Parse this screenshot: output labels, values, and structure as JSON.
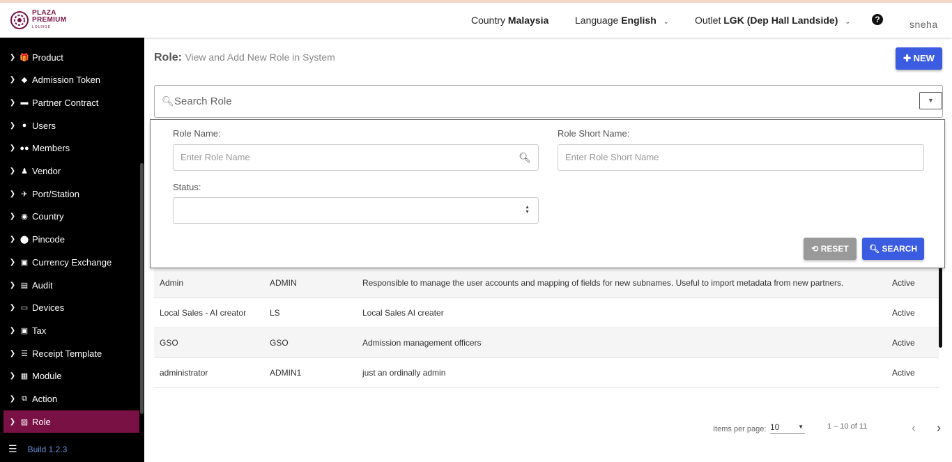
{
  "header": {
    "logo": {
      "line1": "PLAZA",
      "line2": "PREMIUM",
      "line3": "LOUNGE"
    },
    "country_label": "Country",
    "country_value": "Malaysia",
    "language_label": "Language",
    "language_value": "English",
    "outlet_label": "Outlet",
    "outlet_value": "LGK (Dep Hall Landside)",
    "help_icon": "?",
    "user": "sneha"
  },
  "sidebar": {
    "items": [
      {
        "label": "Product",
        "icon": "gift-icon"
      },
      {
        "label": "Admission Token",
        "icon": "tag-icon"
      },
      {
        "label": "Partner Contract",
        "icon": "briefcase-icon"
      },
      {
        "label": "Users",
        "icon": "user-icon"
      },
      {
        "label": "Members",
        "icon": "users-icon"
      },
      {
        "label": "Vendor",
        "icon": "person-icon"
      },
      {
        "label": "Port/Station",
        "icon": "plane-icon"
      },
      {
        "label": "Country",
        "icon": "globe-icon"
      },
      {
        "label": "Pincode",
        "icon": "map-pin-icon"
      },
      {
        "label": "Currency Exchange",
        "icon": "money-icon"
      },
      {
        "label": "Audit",
        "icon": "file-icon"
      },
      {
        "label": "Devices",
        "icon": "laptop-icon"
      },
      {
        "label": "Tax",
        "icon": "money-icon"
      },
      {
        "label": "Receipt Template",
        "icon": "list-icon"
      },
      {
        "label": "Module",
        "icon": "grid-icon"
      },
      {
        "label": "Action",
        "icon": "external-link-icon"
      },
      {
        "label": "Role",
        "icon": "image-icon"
      }
    ],
    "active": "Role",
    "build": "Build 1.2.3"
  },
  "main": {
    "title": "Role:",
    "subtitle": "View and Add New Role in System",
    "new_button": "NEW",
    "search_placeholder": "Search Role",
    "filter": {
      "role_name_label": "Role Name:",
      "role_name_placeholder": "Enter Role Name",
      "role_short_label": "Role Short Name:",
      "role_short_placeholder": "Enter Role Short Name",
      "status_label": "Status:",
      "status_value": "",
      "reset_button": "RESET",
      "search_button": "SEARCH"
    },
    "table": {
      "rows": [
        {
          "name": "Admin",
          "short": "ADMIN",
          "description": "Responsible to manage the user accounts and mapping of fields for new subnames. Useful to import metadata from new partners.",
          "status": "Active"
        },
        {
          "name": "Local Sales - AI creator",
          "short": "LS",
          "description": "Local Sales AI creater",
          "status": "Active"
        },
        {
          "name": "GSO",
          "short": "GSO",
          "description": "Admission management officers",
          "status": "Active"
        },
        {
          "name": "administrator",
          "short": "ADMIN1",
          "description": "just an ordinally admin",
          "status": "Active"
        }
      ]
    },
    "pagination": {
      "items_per_page_label": "Items per page:",
      "items_per_page": "10",
      "range": "1 – 10 of 11"
    }
  },
  "colors": {
    "brand": "#7a1145",
    "primary": "#3b5be0",
    "reset": "#999999"
  }
}
